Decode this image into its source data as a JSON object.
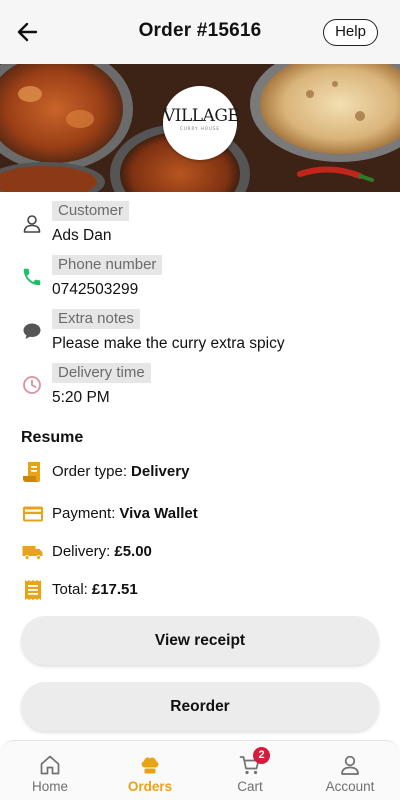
{
  "header": {
    "title": "Order #15616",
    "help_label": "Help"
  },
  "banner": {
    "logo_text": "VILLAGE",
    "logo_subtext": "CURRY HOUSE"
  },
  "info": [
    {
      "icon": "person-icon",
      "label": "Customer",
      "value": "Ads Dan",
      "icon_color": "#444444"
    },
    {
      "icon": "phone-icon",
      "label": "Phone number",
      "value": "0742503299",
      "icon_color": "#1fbf6a"
    },
    {
      "icon": "chat-icon",
      "label": "Extra notes",
      "value": "Please make the curry extra spicy",
      "icon_color": "#555555"
    },
    {
      "icon": "clock-icon",
      "label": "Delivery time",
      "value": "5:20 PM",
      "icon_color": "#d9939c"
    }
  ],
  "resume": {
    "title": "Resume",
    "items": [
      {
        "icon": "receipt-icon",
        "label": "Order type:",
        "value": "Delivery"
      },
      {
        "icon": "credit-card-icon",
        "label": "Payment:",
        "value": "Viva Wallet"
      },
      {
        "icon": "truck-icon",
        "label": "Delivery:",
        "value": "£5.00"
      },
      {
        "icon": "bill-icon",
        "label": "Total:",
        "value": "£17.51"
      }
    ]
  },
  "buttons": {
    "view_receipt": "View receipt",
    "reorder": "Reorder"
  },
  "nav": {
    "items": [
      {
        "icon": "home-icon",
        "label": "Home"
      },
      {
        "icon": "chef-hat-icon",
        "label": "Orders"
      },
      {
        "icon": "cart-icon",
        "label": "Cart"
      },
      {
        "icon": "account-icon",
        "label": "Account"
      }
    ],
    "active": "Orders",
    "cart_badge": "2"
  },
  "colors": {
    "accent": "#e8a317",
    "badge": "#d81b3c",
    "label_bg": "#e6e6e6"
  }
}
